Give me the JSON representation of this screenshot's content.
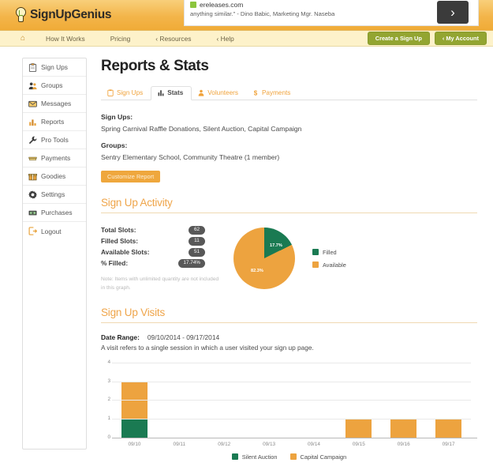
{
  "brand": {
    "logo_text": "SignUpGenius",
    "logo_icon": "lightbulb-icon",
    "accent_orange": "#efa54a",
    "accent_green": "#1a7a52",
    "chart_orange": "#eda33f",
    "olive": "#93a531"
  },
  "ad": {
    "url": "ereleases.com",
    "description": "anything similar.\" - Dino Babic, Marketing Mgr. Naseba",
    "next_label": "›"
  },
  "nav": {
    "home_icon": "home-icon",
    "links": [
      {
        "label": "How It Works"
      },
      {
        "label": "Pricing"
      },
      {
        "label": "‹ Resources"
      },
      {
        "label": "‹ Help"
      }
    ],
    "create_button": "Create a Sign Up",
    "account_button": "‹ My Account"
  },
  "sidebar": {
    "items": [
      {
        "label": "Sign Ups",
        "icon": "clipboard-icon"
      },
      {
        "label": "Groups",
        "icon": "people-icon"
      },
      {
        "label": "Messages",
        "icon": "envelope-icon"
      },
      {
        "label": "Reports",
        "icon": "bar-chart-icon"
      },
      {
        "label": "Pro Tools",
        "icon": "wrench-icon"
      },
      {
        "label": "Payments",
        "icon": "money-icon"
      },
      {
        "label": "Goodies",
        "icon": "gift-icon"
      },
      {
        "label": "Settings",
        "icon": "gear-icon"
      },
      {
        "label": "Purchases",
        "icon": "cash-icon"
      },
      {
        "label": "Logout",
        "icon": "logout-icon"
      }
    ]
  },
  "page": {
    "title": "Reports & Stats",
    "tabs": [
      {
        "label": "Sign Ups",
        "icon": "clipboard-icon",
        "active": false
      },
      {
        "label": "Stats",
        "icon": "bar-chart-icon",
        "active": true
      },
      {
        "label": "Volunteers",
        "icon": "person-icon",
        "active": false
      },
      {
        "label": "Payments",
        "icon": "dollar-icon",
        "active": false
      }
    ],
    "filters": {
      "signups_label": "Sign Ups:",
      "signups_value": "Spring Carnival Raffle Donations, Silent Auction, Capital Campaign",
      "groups_label": "Groups:",
      "groups_value": "Sentry Elementary School, Community Theatre (1 member)",
      "customize_button": "Customize Report"
    },
    "activity": {
      "heading": "Sign Up Activity",
      "stats": [
        {
          "label": "Total Slots:",
          "value": "62"
        },
        {
          "label": "Filled Slots:",
          "value": "11"
        },
        {
          "label": "Available Slots:",
          "value": "51"
        },
        {
          "label": "% Filled:",
          "value": "17.74%"
        }
      ],
      "note": "Note: Items with unlimited quantity are not included in this graph."
    },
    "visits": {
      "heading": "Sign Up Visits",
      "daterange_label": "Date Range:",
      "daterange_value": "09/10/2014 - 09/17/2014",
      "description": "A visit refers to a single session in which a user visited your sign up page."
    }
  },
  "chart_data": [
    {
      "type": "pie",
      "title": "Sign Up Activity",
      "labels": [
        "Filled",
        "Available"
      ],
      "values": [
        17.7,
        82.3
      ],
      "data_labels": [
        "17.7%",
        "82.3%"
      ],
      "colors": [
        "#1a7a52",
        "#eda33f"
      ],
      "legend": [
        "Filled",
        "Available"
      ],
      "legend_position": "right"
    },
    {
      "type": "bar",
      "title": "Sign Up Visits",
      "stacked": true,
      "categories": [
        "09/10",
        "09/11",
        "09/12",
        "09/13",
        "09/14",
        "09/15",
        "09/16",
        "09/17"
      ],
      "series": [
        {
          "name": "Silent Auction",
          "color": "#1a7a52",
          "values": [
            1,
            0,
            0,
            0,
            0,
            0,
            0,
            0
          ]
        },
        {
          "name": "Capital Campaign",
          "color": "#eda33f",
          "values": [
            2,
            0,
            0,
            0,
            0,
            1,
            1,
            1
          ]
        }
      ],
      "yticks": [
        "0",
        "1",
        "2",
        "3",
        "4"
      ],
      "ylim": [
        0,
        4
      ],
      "xlabel": "",
      "ylabel": "",
      "grid": true,
      "legend": [
        "Silent Auction",
        "Capital Campaign"
      ],
      "legend_position": "bottom"
    }
  ]
}
